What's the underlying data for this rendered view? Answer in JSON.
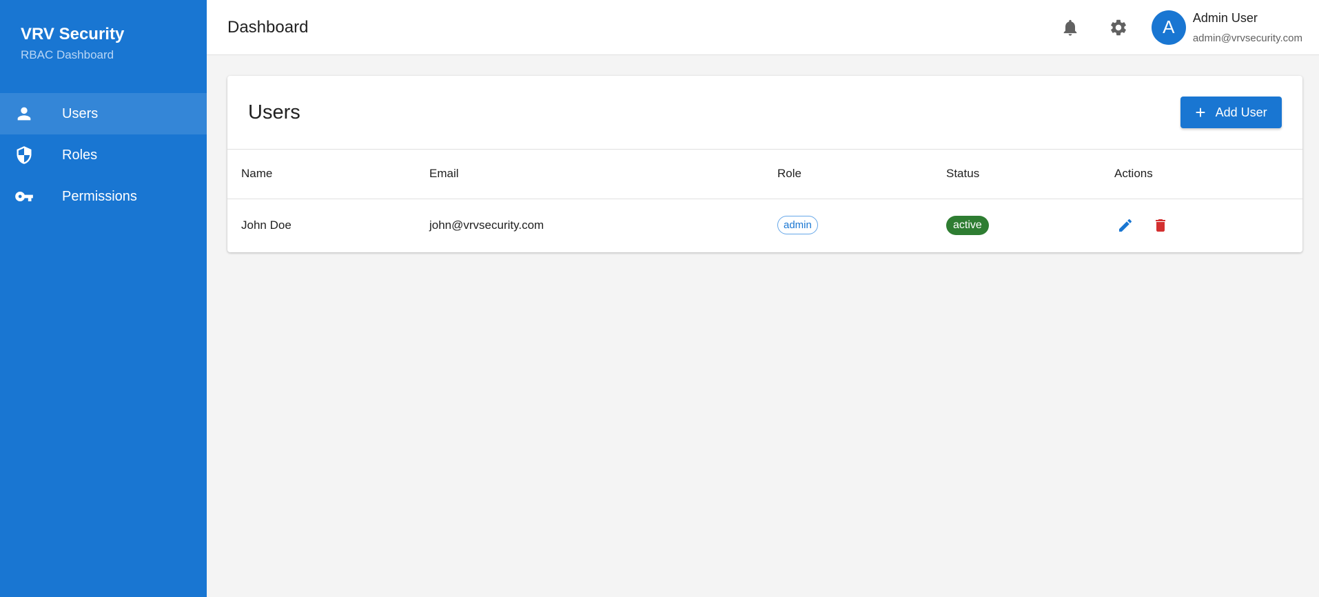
{
  "sidebar": {
    "brand_title": "VRV Security",
    "brand_subtitle": "RBAC Dashboard",
    "items": [
      {
        "label": "Users",
        "icon": "person-icon",
        "active": true
      },
      {
        "label": "Roles",
        "icon": "shield-icon",
        "active": false
      },
      {
        "label": "Permissions",
        "icon": "key-icon",
        "active": false
      }
    ]
  },
  "header": {
    "title": "Dashboard",
    "notifications_icon": "bell-icon",
    "settings_icon": "gear-icon",
    "user": {
      "avatar_initial": "A",
      "name": "Admin User",
      "email": "admin@vrvsecurity.com"
    }
  },
  "users_card": {
    "title": "Users",
    "add_button_label": "Add User",
    "columns": [
      "Name",
      "Email",
      "Role",
      "Status",
      "Actions"
    ],
    "rows": [
      {
        "name": "John Doe",
        "email": "john@vrvsecurity.com",
        "role": "admin",
        "status": "active"
      }
    ]
  },
  "colors": {
    "primary": "#1976d2",
    "status_active": "#2e7d32",
    "delete": "#d32f2f"
  }
}
